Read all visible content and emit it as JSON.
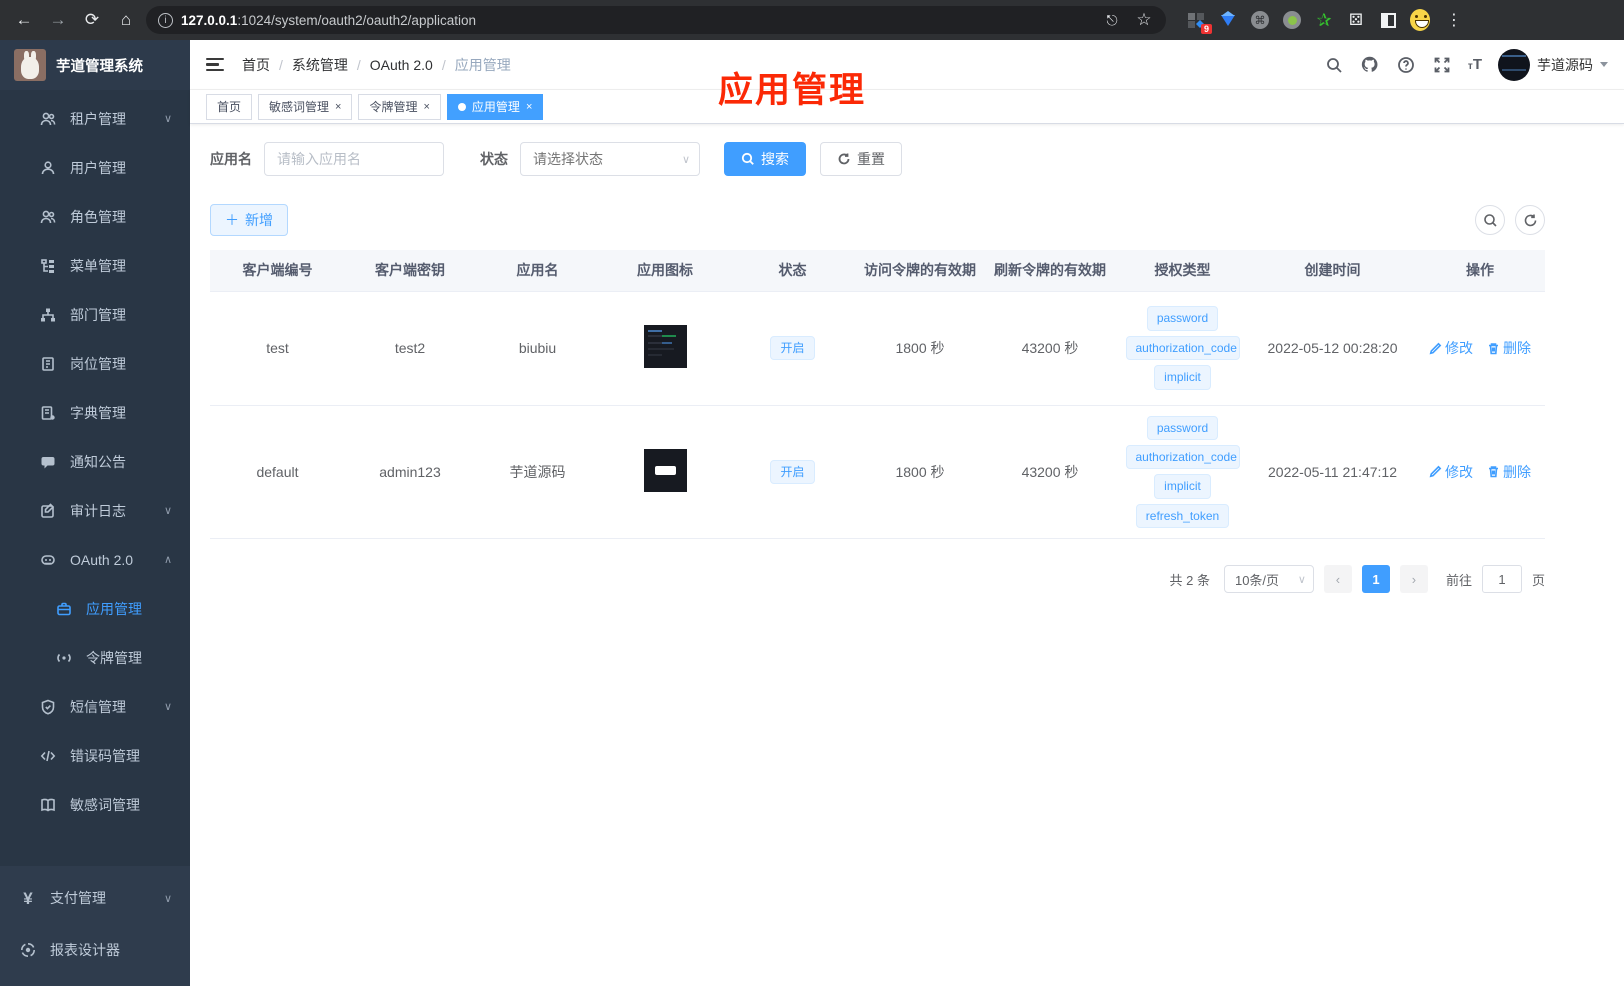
{
  "browser": {
    "url_host": "127.0.0.1",
    "url_rest": ":1024/system/oauth2/oauth2/application",
    "extension_badge": "9"
  },
  "app": {
    "title": "芋道管理系统"
  },
  "sidebar": {
    "items": [
      {
        "label": "租户管理"
      },
      {
        "label": "用户管理"
      },
      {
        "label": "角色管理"
      },
      {
        "label": "菜单管理"
      },
      {
        "label": "部门管理"
      },
      {
        "label": "岗位管理"
      },
      {
        "label": "字典管理"
      },
      {
        "label": "通知公告"
      },
      {
        "label": "审计日志"
      },
      {
        "label": "OAuth 2.0"
      },
      {
        "label": "应用管理"
      },
      {
        "label": "令牌管理"
      },
      {
        "label": "短信管理"
      },
      {
        "label": "错误码管理"
      },
      {
        "label": "敏感词管理"
      },
      {
        "label": "支付管理"
      },
      {
        "label": "报表设计器"
      }
    ]
  },
  "header": {
    "breadcrumb": [
      "首页",
      "系统管理",
      "OAuth 2.0",
      "应用管理"
    ],
    "user_name": "芋道源码"
  },
  "tabs": [
    {
      "label": "首页"
    },
    {
      "label": "敏感词管理"
    },
    {
      "label": "令牌管理"
    },
    {
      "label": "应用管理"
    }
  ],
  "annotation": "应用管理",
  "filter": {
    "name_label": "应用名",
    "name_placeholder": "请输入应用名",
    "status_label": "状态",
    "status_placeholder": "请选择状态",
    "search_label": "搜索",
    "reset_label": "重置",
    "add_label": "新增"
  },
  "table": {
    "headers": [
      "客户端编号",
      "客户端密钥",
      "应用名",
      "应用图标",
      "状态",
      "访问令牌的有效期",
      "刷新令牌的有效期",
      "授权类型",
      "创建时间",
      "操作"
    ],
    "rows": [
      {
        "client_id": "test",
        "secret": "test2",
        "name": "biubiu",
        "icon": "dark-app-screenshot",
        "status": "开启",
        "access_validity": "1800 秒",
        "refresh_validity": "43200 秒",
        "grants": [
          "password",
          "authorization_code",
          "implicit"
        ],
        "created": "2022-05-12 00:28:20",
        "edit_label": "修改",
        "delete_label": "删除"
      },
      {
        "client_id": "default",
        "secret": "admin123",
        "name": "芋道源码",
        "icon": "dark-gitee-logo",
        "status": "开启",
        "access_validity": "1800 秒",
        "refresh_validity": "43200 秒",
        "grants": [
          "password",
          "authorization_code",
          "implicit",
          "refresh_token"
        ],
        "created": "2022-05-11 21:47:12",
        "edit_label": "修改",
        "delete_label": "删除"
      }
    ]
  },
  "pagination": {
    "total": "共 2 条",
    "page_size": "10条/页",
    "current_page": "1",
    "goto_label": "前往",
    "goto_value": "1",
    "unit_label": "页"
  },
  "colors": {
    "accent": "#409eff",
    "annotation_red": "#fb2906",
    "sidebar_bg": "#293645"
  }
}
